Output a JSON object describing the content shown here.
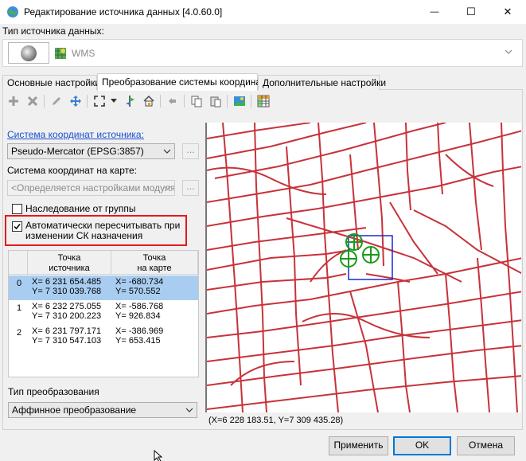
{
  "window": {
    "title": "Редактирование источника данных [4.0.60.0]",
    "controls": {
      "minimize": "—",
      "maximize": "☐",
      "close": "✕"
    }
  },
  "data_source": {
    "label": "Тип источника данных:",
    "value": "WMS"
  },
  "tabs": [
    {
      "label": "Основные настройки"
    },
    {
      "label": "Преобразование системы координат"
    },
    {
      "label": "Дополнительные настройки"
    }
  ],
  "toolbar": {
    "icons": [
      "add-point-icon",
      "delete-point-icon",
      "edit-pencil-icon",
      "move-icon",
      "full-extent-icon",
      "zoom-dropdown-icon",
      "layer-icon",
      "home-icon",
      "undo-icon",
      "copy-icon",
      "paste-icon",
      "image-icon",
      "table-icon"
    ]
  },
  "left": {
    "src_cs_link": "Система координат источника:",
    "src_cs_value": "Pseudo-Mercator (EPSG:3857)",
    "map_cs_label": "Система координат на карте:",
    "map_cs_value": "<Определяется настройками модуля>",
    "dots": "...",
    "inherit_label": "Наследование от группы",
    "auto_recalc_label_1": "Автоматически пересчитывать при",
    "auto_recalc_label_2": "изменении СК назначения",
    "table": {
      "col_src_1": "Точка",
      "col_src_2": "источника",
      "col_map_1": "Точка",
      "col_map_2": "на карте",
      "rows": [
        {
          "idx": "0",
          "src_x": "X= 6 231 654.485",
          "src_y": "Y= 7 310 039.768",
          "map_x": "X= -680.734",
          "map_y": "Y= 570.552"
        },
        {
          "idx": "1",
          "src_x": "X= 6 232 275.055",
          "src_y": "Y= 7 310 200.223",
          "map_x": "X= -586.768",
          "map_y": "Y= 926.834"
        },
        {
          "idx": "2",
          "src_x": "X= 6 231 797.171",
          "src_y": "Y= 7 310 547.103",
          "map_x": "X= -386.969",
          "map_y": "Y= 653.415"
        }
      ]
    },
    "transform_label": "Тип преобразования",
    "transform_value": "Аффинное преобразование"
  },
  "map": {
    "coords": "(X=6 228 183.51, Y=7 309 435.28)",
    "road_color": "#c8323a",
    "marker_color": "#1a9a1a",
    "selection_color": "#1c28d4"
  },
  "buttons": {
    "apply": "Применить",
    "ok": "OK",
    "cancel": "Отмена"
  }
}
